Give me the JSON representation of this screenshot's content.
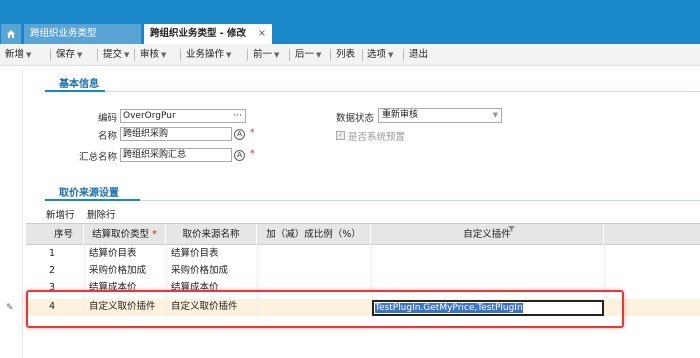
{
  "tabs": {
    "home_icon": "home-icon",
    "tab1": "跨组织业务类型",
    "tab2": "跨组织业务类型 - 修改",
    "close_glyph": "×"
  },
  "toolbar": {
    "items": [
      "新增",
      "保存",
      "提交",
      "审核",
      "业务操作",
      "前一",
      "后一",
      "列表",
      "选项",
      "退出"
    ],
    "dropdown_glyph": "▼"
  },
  "sections": {
    "basic": "基本信息",
    "price_source": "取价来源设置"
  },
  "form": {
    "code_label": "编码",
    "code_value": "OverOrgPur",
    "code_btn": "···",
    "name_label": "名称",
    "name_value": "跨组织采购",
    "summary_label": "汇总名称",
    "summary_value": "跨组织采购汇总",
    "required": "*",
    "data_status_label": "数据状态",
    "data_status_value": "重新审核",
    "system_preset_label": "是否系统预置",
    "check_glyph": "✓",
    "lang_icon": "A"
  },
  "grid": {
    "add_row": "新增行",
    "delete_row": "删除行",
    "headers": [
      "序号",
      "结算取价类型",
      "取价来源名称",
      "加（减）成比例（%）",
      "自定义插件"
    ],
    "required_mark": "*",
    "rows": [
      {
        "seq": "1",
        "type": "结算价目表",
        "source": "结算价目表",
        "ratio": "",
        "plugin": ""
      },
      {
        "seq": "2",
        "type": "采购价格加成",
        "source": "采购价格加成",
        "ratio": "",
        "plugin": ""
      },
      {
        "seq": "3",
        "type": "结算成本价",
        "source": "结算成本价",
        "ratio": "",
        "plugin": ""
      },
      {
        "seq": "4",
        "type": "自定义取价插件",
        "source": "自定义取价插件",
        "ratio": "",
        "plugin": "TestPlugIn.GetMyPrice,TestPlugIn"
      }
    ],
    "edit_icon": "✎"
  },
  "colors": {
    "tabbar": "#1a87c9",
    "selected_row": "#fbf1dc",
    "highlight_border": "#e53935"
  }
}
